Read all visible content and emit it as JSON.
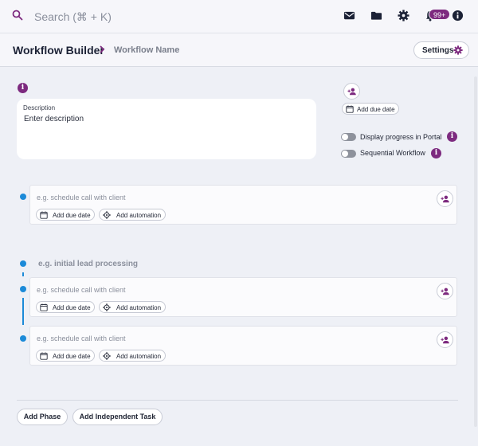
{
  "topbar": {
    "search_placeholder": "Search (⌘ + K)",
    "notification_badge": "99+",
    "icons": [
      "search-icon",
      "mail-icon",
      "folder-icon",
      "gear-icon",
      "bell-icon",
      "info-icon"
    ]
  },
  "header": {
    "title": "Workflow Builder",
    "workflow_name": "Workflow Name",
    "settings_label": "Settings"
  },
  "description": {
    "label": "Description",
    "placeholder": "Enter description"
  },
  "side_panel": {
    "due_date_label": "Add due date",
    "toggles": [
      {
        "label": "Display progress in Portal",
        "on": false
      },
      {
        "label": "Sequential Workflow",
        "on": false
      }
    ]
  },
  "independent_task": {
    "placeholder": "e.g. schedule call with client",
    "due_date_label": "Add due date",
    "automation_label": "Add automation"
  },
  "phase": {
    "placeholder": "e.g. initial lead processing",
    "tasks": [
      {
        "placeholder": "e.g. schedule call with client",
        "due_date_label": "Add due date",
        "automation_label": "Add automation"
      },
      {
        "placeholder": "e.g. schedule call with client",
        "due_date_label": "Add due date",
        "automation_label": "Add automation"
      }
    ]
  },
  "footer": {
    "add_phase_label": "Add Phase",
    "add_task_label": "Add Independent Task"
  },
  "colors": {
    "accent": "#7d2a7f",
    "dot": "#1c8ad8",
    "navy": "#1c2236"
  }
}
